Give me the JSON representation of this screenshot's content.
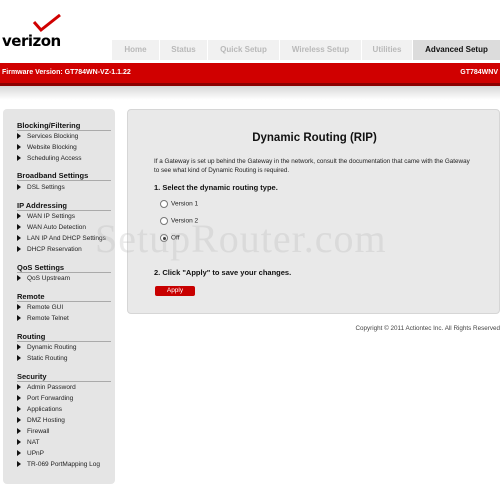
{
  "brand": {
    "logo_text": "verizon",
    "accent_color": "#d00000"
  },
  "tabs": [
    {
      "label": "Home"
    },
    {
      "label": "Status"
    },
    {
      "label": "Quick Setup"
    },
    {
      "label": "Wireless Setup"
    },
    {
      "label": "Utilities"
    },
    {
      "label": "Advanced Setup",
      "active": true
    }
  ],
  "redbar": {
    "firmware": "Firmware Version: GT784WN-VZ-1.1.22",
    "model": "GT784WNV"
  },
  "sidebar": {
    "sections": [
      {
        "title": "Blocking/Filtering",
        "items": [
          "Services Blocking",
          "Website Blocking",
          "Scheduling Access"
        ]
      },
      {
        "title": "Broadband Settings",
        "items": [
          "DSL Settings"
        ]
      },
      {
        "title": "IP Addressing",
        "items": [
          "WAN IP Settings",
          "WAN Auto Detection",
          "LAN IP And DHCP Settings",
          "DHCP Reservation"
        ]
      },
      {
        "title": "QoS Settings",
        "items": [
          "QoS Upstream"
        ]
      },
      {
        "title": "Remote",
        "items": [
          "Remote GUI",
          "Remote Telnet"
        ]
      },
      {
        "title": "Routing",
        "items": [
          "Dynamic Routing",
          "Static Routing"
        ]
      },
      {
        "title": "Security",
        "items": [
          "Admin Password",
          "Port Forwarding",
          "Applications",
          "DMZ Hosting",
          "Firewall",
          "NAT",
          "UPnP",
          "TR-069 PortMapping Log"
        ]
      }
    ]
  },
  "main": {
    "title": "Dynamic Routing (RIP)",
    "description": "If a Gateway is set up behind the Gateway in the network, consult the documentation that came with the Gateway to see what kind of Dynamic Routing is required.",
    "step1": "1. Select the dynamic routing type.",
    "options": [
      {
        "label": "Version 1",
        "checked": false
      },
      {
        "label": "Version 2",
        "checked": false
      },
      {
        "label": "Off",
        "checked": true
      }
    ],
    "step2": "2. Click \"Apply\" to save your changes.",
    "apply_label": "Apply"
  },
  "footer": {
    "copyright": "Copyright © 2011 Actiontec Inc. All Rights Reserved"
  },
  "watermark": "SetupRouter.com"
}
